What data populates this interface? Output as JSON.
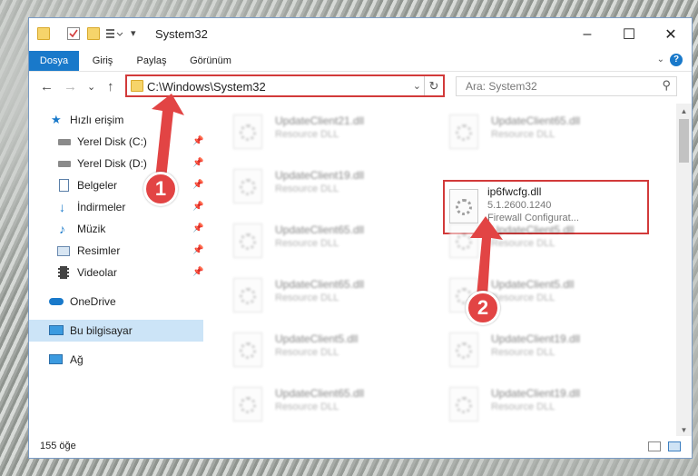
{
  "window": {
    "title": "System32"
  },
  "ribbon": {
    "tabs": [
      "Dosya",
      "Giriş",
      "Paylaş",
      "Görünüm"
    ],
    "help": "?"
  },
  "navigation": {
    "back": "←",
    "forward": "→",
    "recent": "⌄",
    "up": "↑",
    "address": "C:\\Windows\\System32",
    "search_placeholder": "Ara: System32"
  },
  "sidebar": {
    "items": [
      {
        "label": "Hızlı erişim",
        "icon": "star-icon",
        "pinned": false
      },
      {
        "label": "Yerel Disk (C:)",
        "icon": "drive-icon",
        "pinned": true
      },
      {
        "label": "Yerel Disk (D:)",
        "icon": "drive-icon",
        "pinned": true
      },
      {
        "label": "Belgeler",
        "icon": "documents-icon",
        "pinned": true
      },
      {
        "label": "İndirmeler",
        "icon": "download-icon",
        "pinned": true
      },
      {
        "label": "Müzik",
        "icon": "music-icon",
        "pinned": true
      },
      {
        "label": "Resimler",
        "icon": "pictures-icon",
        "pinned": true
      },
      {
        "label": "Videolar",
        "icon": "videos-icon",
        "pinned": true
      },
      {
        "label": "OneDrive",
        "icon": "cloud-icon",
        "pinned": false
      },
      {
        "label": "Bu bilgisayar",
        "icon": "computer-icon",
        "pinned": false,
        "selected": true
      },
      {
        "label": "Ağ",
        "icon": "network-icon",
        "pinned": false
      }
    ]
  },
  "files": [
    {
      "name": "UpdateClient21.dll",
      "type": "Resource DLL",
      "blurred": true
    },
    {
      "name": "UpdateClient65.dll",
      "type": "Resource DLL",
      "blurred": true
    },
    {
      "name": "UpdateClient19.dll",
      "type": "Resource DLL",
      "blurred": true
    },
    {
      "name": "ip6fwcfg.dll",
      "version": "5.1.2600.1240",
      "type": "Firewall Configurat...",
      "blurred": false,
      "highlighted": true
    },
    {
      "name": "UpdateClient65.dll",
      "type": "Resource DLL",
      "blurred": true
    },
    {
      "name": "UpdateClient5.dll",
      "type": "Resource DLL",
      "blurred": true
    },
    {
      "name": "UpdateClient65.dll",
      "type": "Resource DLL",
      "blurred": true
    },
    {
      "name": "UpdateClient5.dll",
      "type": "Resource DLL",
      "blurred": true
    },
    {
      "name": "UpdateClient5.dll",
      "type": "Resource DLL",
      "blurred": true
    },
    {
      "name": "UpdateClient19.dll",
      "type": "Resource DLL",
      "blurred": true
    },
    {
      "name": "UpdateClient65.dll",
      "type": "Resource DLL",
      "blurred": true
    },
    {
      "name": "UpdateClient19.dll",
      "type": "Resource DLL",
      "blurred": true
    }
  ],
  "status": {
    "count": "155 öğe"
  },
  "callouts": [
    "1",
    "2"
  ],
  "colors": {
    "accent": "#1979ca",
    "highlight": "#d23a3a",
    "callout": "#e24444",
    "selection": "#cce4f7"
  }
}
